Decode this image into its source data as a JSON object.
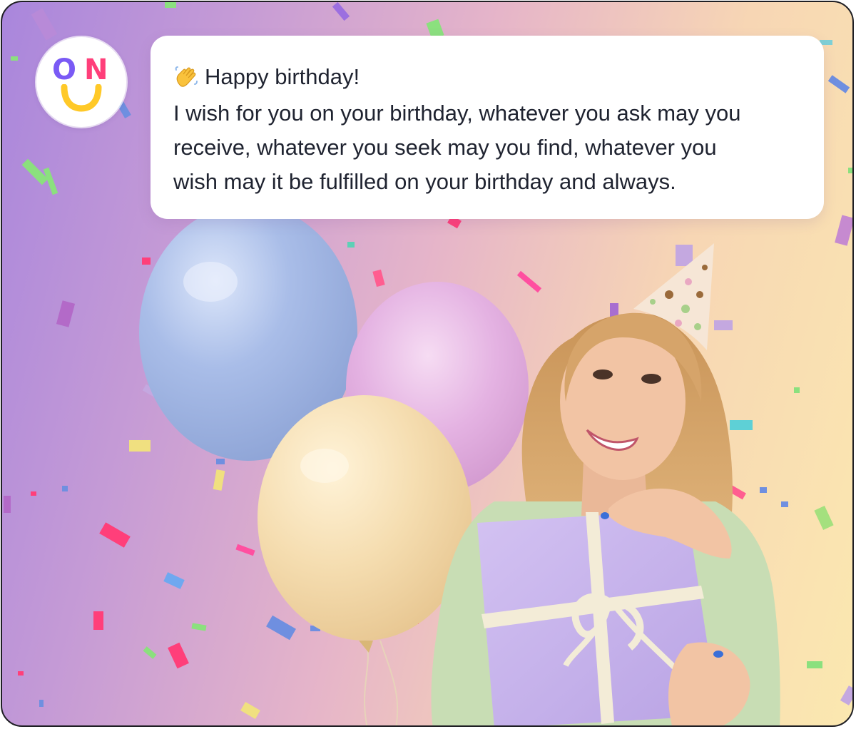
{
  "logo": {
    "letter_o": "O",
    "letter_n": "N",
    "color_o": "#7a5af5",
    "color_n": "#ff3f7a",
    "smile_color": "#ffc928"
  },
  "message": {
    "title": "Happy birthday!",
    "title_icon": "waving-hand-icon",
    "body": "I wish for you on your birthday, whatever you ask may you\nreceive, whatever you seek may you find, whatever you\nwish may it be fulfilled on your birthday and always."
  },
  "colors": {
    "frame_border": "#1f1f24",
    "balloon_blue": "#a9bde8",
    "balloon_pink": "#e4b2e2",
    "balloon_yellow": "#f5ddb0",
    "gift_box": "#c9b5ec",
    "ribbon": "#f3ecd7"
  }
}
